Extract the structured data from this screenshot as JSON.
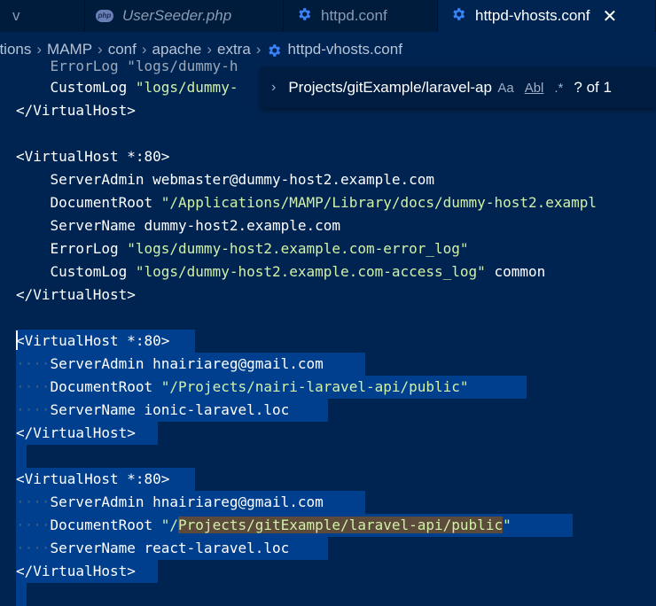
{
  "tabs": [
    {
      "label": "v",
      "icon": "none"
    },
    {
      "label": "UserSeeder.php",
      "icon": "php-icon"
    },
    {
      "label": "httpd.conf",
      "icon": "gear-icon"
    },
    {
      "label": "httpd-vhosts.conf",
      "icon": "gear-icon",
      "active": true
    }
  ],
  "breadcrumb": [
    "ations",
    "MAMP",
    "conf",
    "apache",
    "extra",
    "httpd-vhosts.conf"
  ],
  "find": {
    "query": "Projects/gitExample/laravel-api/public",
    "options": [
      "Aa",
      "Abl",
      ".*"
    ],
    "count": "? of 1"
  },
  "code": {
    "l0": "    ErrorLog \"logs/dummy-h",
    "l1a": "    CustomLog ",
    "l1b": "\"logs/dummy-",
    "l2": "</VirtualHost>",
    "l4": "<VirtualHost *:80>",
    "l5a": "    ServerAdmin webmaster@dummy-host2.example.com",
    "l6a": "    DocumentRoot ",
    "l6b": "\"/Applications/MAMP/Library/docs/dummy-host2.exampl",
    "l7": "    ServerName dummy-host2.example.com",
    "l8a": "    ErrorLog ",
    "l8b": "\"logs/dummy-host2.example.com-error_log\"",
    "l9a": "    CustomLog ",
    "l9b": "\"logs/dummy-host2.example.com-access_log\"",
    "l9c": " common",
    "l10": "</VirtualHost>",
    "l12": "<VirtualHost *:80>",
    "l13a": "ServerAdmin hnairiareg@gmail.com",
    "l14a": "DocumentRoot ",
    "l14b": "\"/Projects/nairi-laravel-api/public\"",
    "l15a": "ServerName ionic-laravel.loc",
    "l16": "</VirtualHost>",
    "l18": "<VirtualHost *:80>",
    "l19a": "ServerAdmin hnairiareg@gmail.com",
    "l20a": "DocumentRoot ",
    "l20b": "\"/",
    "l20c": "Projects/gitExample/laravel-api/public",
    "l20d": "\"",
    "l21a": "ServerName react-laravel.loc",
    "l22": "</VirtualHost>"
  },
  "colors": {
    "background": "#002451",
    "string": "#d1f1a9",
    "selection": "#003f8e"
  }
}
